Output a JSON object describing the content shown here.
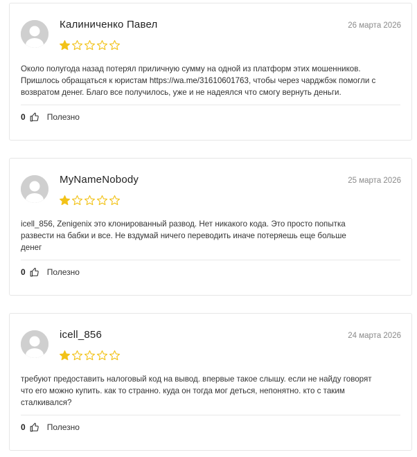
{
  "reviews": [
    {
      "author": "Калиниченко Павел",
      "date": "26 марта 2026",
      "rating": 1,
      "max_rating": 5,
      "text_before_link": "Около полугода назад потерял приличную сумму на одной из платформ этих мошенников.\nПришлось обращаться к юристам ",
      "link": "https://wa.me/31610601763",
      "text_after_link": ", чтобы через чарджбэк помогли с\nвозвратом денег. Благо все получилось, уже и не надеялся что смогу вернуть деньги.",
      "likes": "0",
      "helpful_label": "Полезно"
    },
    {
      "author": "MyNameNobody",
      "date": "25 марта 2026",
      "rating": 1,
      "max_rating": 5,
      "text_before_link": "icell_856, Zenigenix это клонированный развод. Нет никакого кода. Это просто попытка\nразвести на бабки и все. Не вздумай ничего переводить иначе потеряешь еще больше\nденег",
      "link": "",
      "text_after_link": "",
      "likes": "0",
      "helpful_label": "Полезно"
    },
    {
      "author": "icell_856",
      "date": "24 марта 2026",
      "rating": 1,
      "max_rating": 5,
      "text_before_link": "требуют предоставить налоговый код на вывод. впервые такое слышу. если не найду говорят\nчто его можно купить. как то странно. куда он тогда мог деться, непонятно. кто с таким\nсталкивался?",
      "link": "",
      "text_after_link": "",
      "likes": "0",
      "helpful_label": "Полезно"
    }
  ],
  "colors": {
    "star_filled": "#f2c218",
    "star_empty_stroke": "#f2c218",
    "avatar_bg": "#c9c9c9"
  },
  "icons": {
    "avatar": "user-placeholder-icon",
    "star": "star-icon",
    "like": "thumbs-up-icon"
  }
}
